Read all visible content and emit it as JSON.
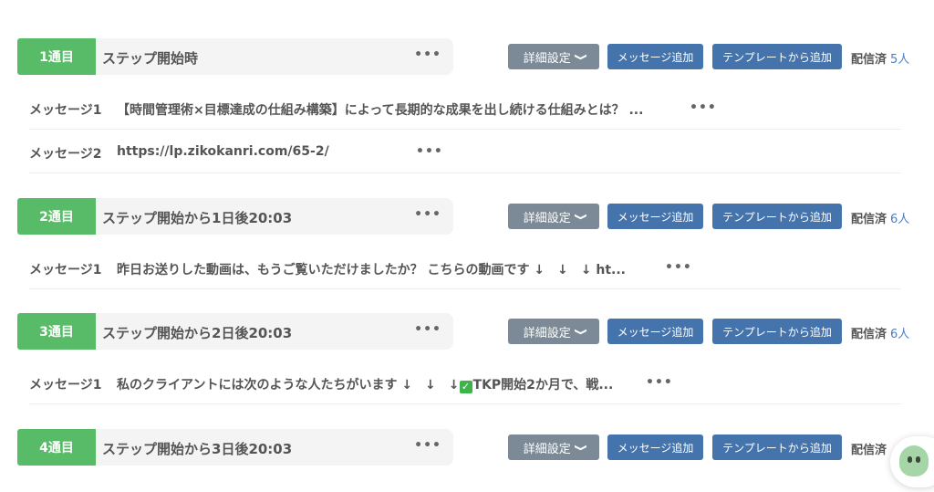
{
  "common": {
    "detail_label": "詳細設定",
    "add_message_label": "メッセージ追加",
    "add_template_label": "テンプレートから追加",
    "sent_label": "配信済",
    "more_glyph": "•••",
    "chevron_glyph": "❯"
  },
  "steps": [
    {
      "number": "1通目",
      "title": "ステップ開始時",
      "sent_count": "5人",
      "messages": [
        {
          "label": "メッセージ1",
          "text": "【時間管理術×目標達成の仕組み構築】によって長期的な成果を出し続ける仕組みとは？ ..."
        },
        {
          "label": "メッセージ2",
          "text": "https://lp.zikokanri.com/65-2/"
        }
      ]
    },
    {
      "number": "2通目",
      "title": "ステップ開始から1日後20:03",
      "sent_count": "6人",
      "messages": [
        {
          "label": "メッセージ1",
          "text": "昨日お送りした動画は、もうご覧いただけましたか？ こちらの動画です ↓　↓　↓ ht..."
        }
      ]
    },
    {
      "number": "3通目",
      "title": "ステップ開始から2日後20:03",
      "sent_count": "6人",
      "messages": [
        {
          "label": "メッセージ1",
          "text_before": "私のクライアントには次のような人たちがいます ↓　↓　↓",
          "check": "✓",
          "text_after": "TKP開始2か月で、戦..."
        }
      ]
    },
    {
      "number": "4通目",
      "title": "ステップ開始から3日後20:03",
      "sent_count": "",
      "messages": []
    }
  ]
}
